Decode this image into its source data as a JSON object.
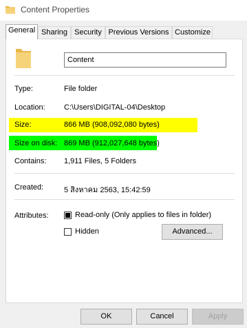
{
  "window": {
    "title": "Content Properties"
  },
  "tabs": [
    "General",
    "Sharing",
    "Security",
    "Previous Versions",
    "Customize"
  ],
  "general": {
    "name_value": "Content",
    "type_label": "Type:",
    "type_value": "File folder",
    "location_label": "Location:",
    "location_value": "C:\\Users\\DIGITAL-04\\Desktop",
    "size_label": "Size:",
    "size_value": "866 MB (908,092,080 bytes)",
    "size_on_disk_label": "Size on disk:",
    "size_on_disk_value": "869 MB (912,027,648 bytes)",
    "contains_label": "Contains:",
    "contains_value": "1,911 Files, 5 Folders",
    "created_label": "Created:",
    "created_value": "5 สิงหาคม 2563, 15:42:59",
    "attributes_label": "Attributes:",
    "readonly_label": "Read-only (Only applies to files in folder)",
    "readonly_checked": true,
    "hidden_label": "Hidden",
    "hidden_checked": false,
    "advanced_button": "Advanced..."
  },
  "footer": {
    "ok": "OK",
    "cancel": "Cancel",
    "apply": "Apply"
  },
  "colors": {
    "size_highlight": "#ffff00",
    "size_on_disk_highlight": "#00ff00",
    "folder_icon": "#e8b84a"
  },
  "icons": {
    "title": "folder-icon",
    "main": "folder-icon"
  }
}
